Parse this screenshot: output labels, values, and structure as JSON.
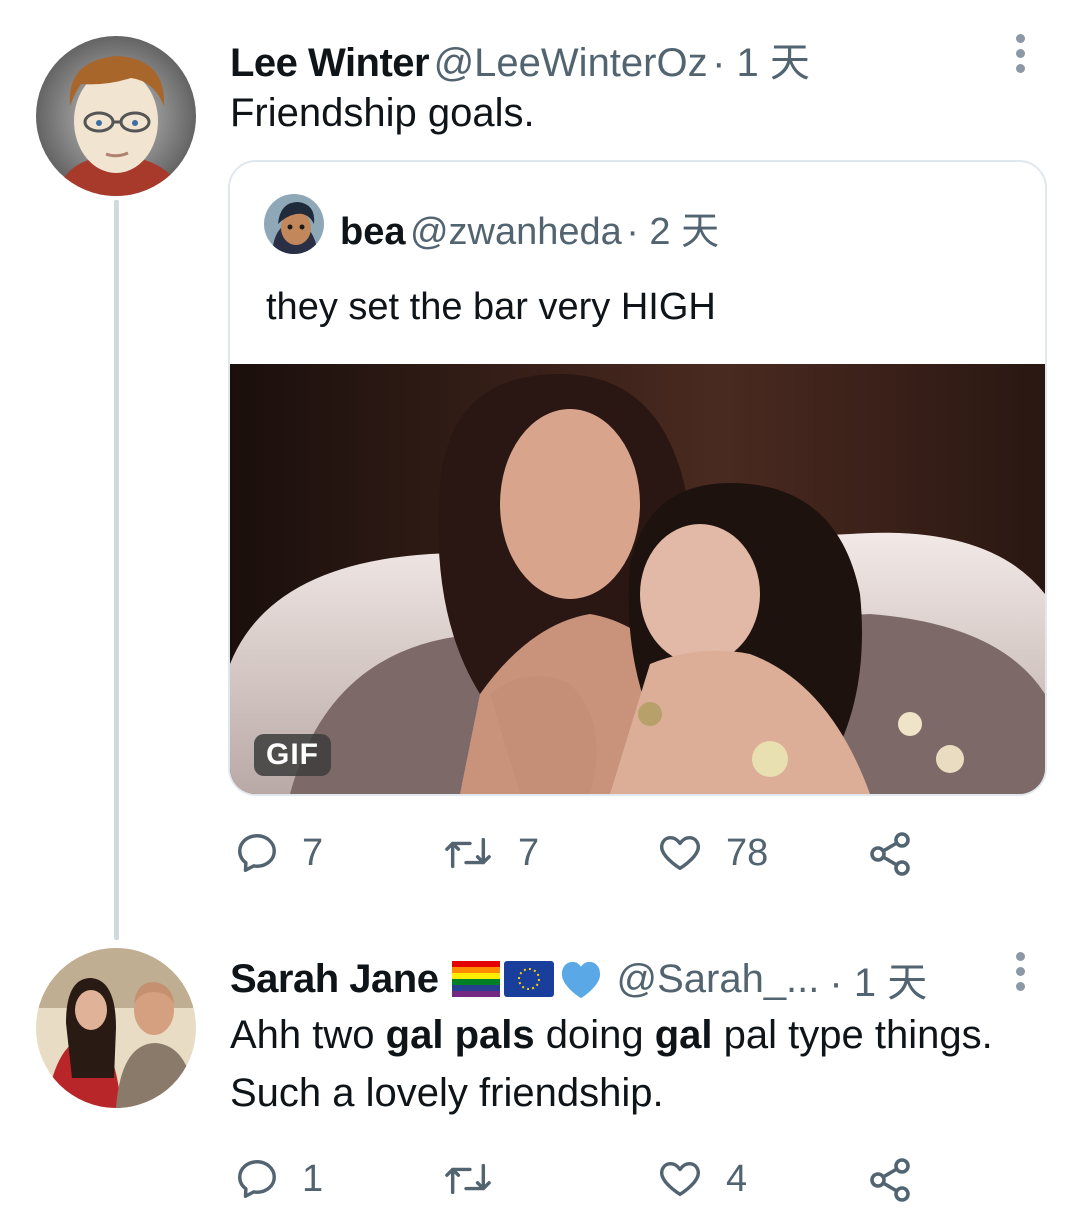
{
  "tweet1": {
    "name": "Lee Winter",
    "handle": "@LeeWinterOz",
    "time": "· 1 天",
    "text": "Friendship goals.",
    "quote": {
      "name": "bea",
      "handle": "@zwanheda",
      "time": "· 2 天",
      "text": "they set the bar very HIGH",
      "media_badge": "GIF"
    },
    "actions": {
      "replies": "7",
      "retweets": "7",
      "likes": "78"
    }
  },
  "tweet2": {
    "name": "Sarah Jane",
    "handle": "@Sarah_...",
    "time": "· 1 天",
    "text_parts": [
      "Ahh two ",
      "gal pals",
      " doing ",
      "gal",
      " pal type things. Such a lovely friendship."
    ],
    "actions": {
      "replies": "1",
      "retweets": "",
      "likes": "4"
    }
  },
  "colors": {
    "secondary_text": "#536471",
    "border": "#e1e8ed",
    "thread_line": "#cfd9de",
    "heart_emoji": "#5aa9e6"
  }
}
